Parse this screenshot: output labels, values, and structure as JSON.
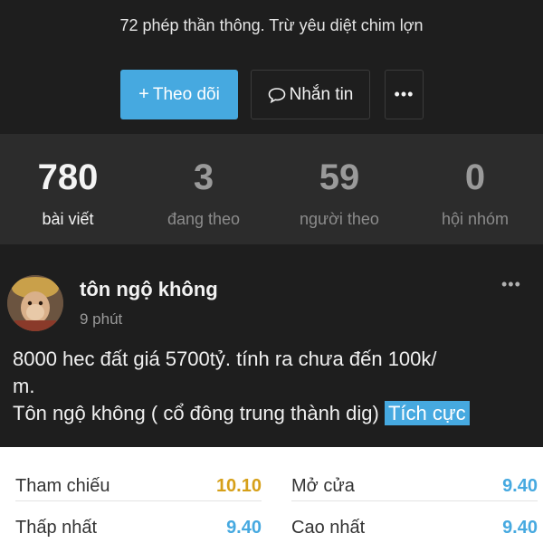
{
  "profile": {
    "bio": "72 phép thần thông. Trừ yêu diệt chim lợn"
  },
  "actions": {
    "follow_label": "Theo dõi",
    "message_label": "Nhắn tin",
    "more_label": "•••"
  },
  "stats": [
    {
      "value": "780",
      "label": "bài viết"
    },
    {
      "value": "3",
      "label": "đang theo"
    },
    {
      "value": "59",
      "label": "người theo"
    },
    {
      "value": "0",
      "label": "hội nhóm"
    }
  ],
  "post": {
    "author": "tôn ngộ không",
    "time": "9 phút",
    "more_label": "•••",
    "lines": [
      "8000 hec đất giá 5700tỷ.  tính ra chưa đến 100k/",
      "m.",
      "Tôn ngộ không ( cổ đông trung thành dig)"
    ],
    "tag": "Tích cực"
  },
  "quote": {
    "ref_label": "Tham chiếu",
    "ref_value": "10.10",
    "open_label": "Mở cửa",
    "open_value": "9.40",
    "low_label": "Thấp nhất",
    "low_value": "9.40",
    "high_label": "Cao nhất",
    "high_value": "9.40"
  },
  "colors": {
    "accent": "#46a9e0",
    "ref_color": "#d6a019",
    "price_color": "#46a9e0"
  },
  "icons": {
    "follow": "plus-icon",
    "message": "chat-bubble-icon"
  }
}
